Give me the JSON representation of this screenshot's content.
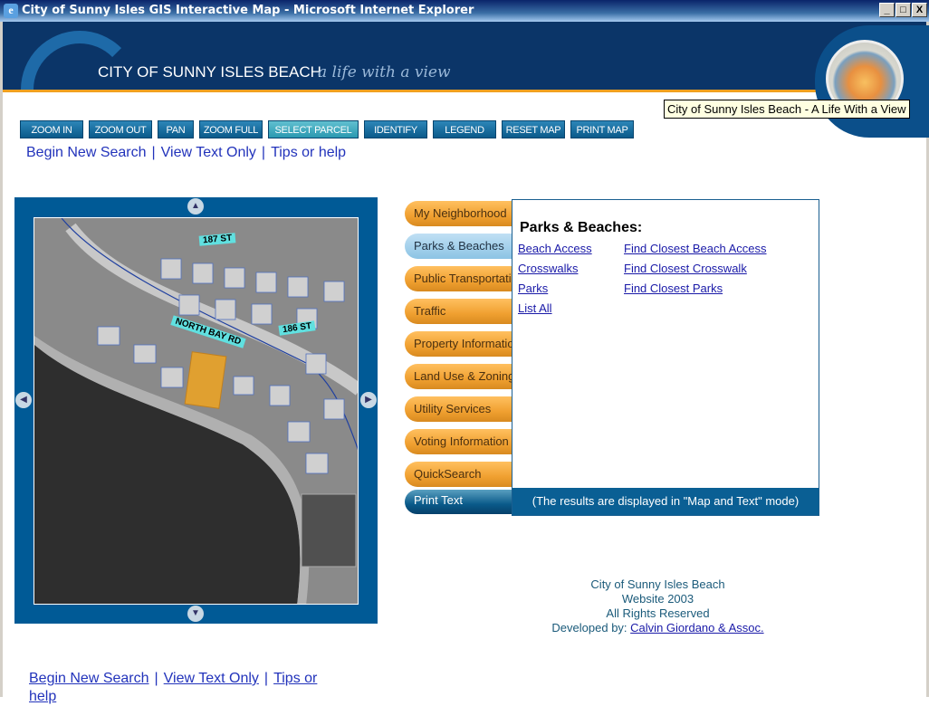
{
  "window": {
    "title": "City of Sunny Isles GIS Interactive Map - Microsoft Internet Explorer",
    "buttons": [
      "_",
      "□",
      "X"
    ]
  },
  "banner": {
    "name": "CITY OF SUNNY ISLES BEACH",
    "tagline": "a life with a view",
    "seal_text": "CITY OF SUNNY ISLES BEACH"
  },
  "tooltip": "City of Sunny Isles Beach - A Life With a View",
  "toolbar": [
    "ZOOM IN",
    "ZOOM OUT",
    "PAN",
    "ZOOM FULL",
    "SELECT PARCEL",
    "IDENTIFY",
    "LEGEND",
    "RESET MAP",
    "PRINT MAP"
  ],
  "toolbar_active": "SELECT PARCEL",
  "nav_links": [
    "Begin New Search",
    "View Text Only",
    "Tips or help"
  ],
  "map": {
    "labels": [
      "187 ST",
      "NORTH BAY RD",
      "186 ST"
    ]
  },
  "tabs": [
    "My Neighborhood",
    "Parks & Beaches",
    "Public Transportation",
    "Traffic",
    "Property Information",
    "Land Use & Zoning",
    "Utility Services",
    "Voting Information",
    "QuickSearch",
    "Print Text"
  ],
  "selected_tab": "Parks & Beaches",
  "panel": {
    "title": "Parks & Beaches:",
    "left_links": [
      "Beach Access",
      "Crosswalks",
      "Parks",
      "List All"
    ],
    "right_links": [
      "Find Closest Beach Access",
      "Find Closest Crosswalk",
      "Find Closest Parks"
    ],
    "footer": "(The results are displayed in \"Map and Text\" mode)"
  },
  "credits": {
    "lines": [
      "City of Sunny Isles Beach",
      "Website 2003",
      "All Rights Reserved"
    ],
    "developed_label": "Developed by:",
    "developer": "Calvin Giordano & Assoc."
  },
  "colors": {
    "banner": "#0b3568",
    "accent": "#f0a020",
    "frame": "#005a96",
    "tab": "#f0a030",
    "link": "#1a1aa8"
  }
}
